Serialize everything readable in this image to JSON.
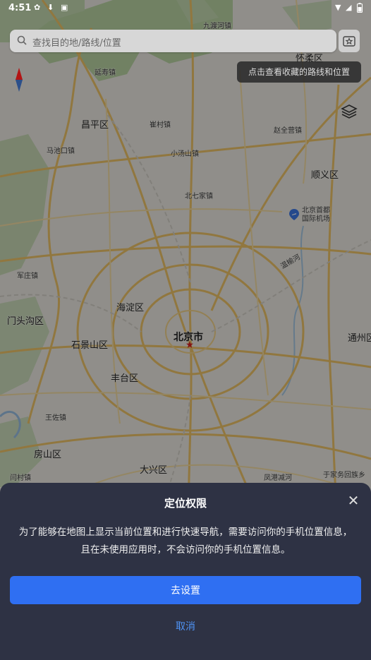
{
  "status_bar": {
    "time": "4:51",
    "battery_icon": "battery-icon"
  },
  "search": {
    "placeholder": "查找目的地/路线/位置"
  },
  "favorites_tip": "点击查看收藏的路线和位置",
  "map_labels": {
    "beijing": "北京市",
    "haidian": "海淀区",
    "changping": "昌平区",
    "shunyi": "顺义区",
    "mentougou": "门头沟区",
    "shijingshan": "石景山区",
    "fengtai": "丰台区",
    "fangshan": "房山区",
    "daxing": "大兴区",
    "huairou": "怀柔区",
    "tongzhou": "通州区",
    "airport": "北京首都\n国际机场",
    "jiudu_river": "九渡河镇",
    "yanshou": "延寿镇",
    "cuicun": "崔村镇",
    "zhaoquanying": "赵全营镇",
    "machikou": "马池口镇",
    "xiaotangshan": "小汤山镇",
    "beiqijia": "北七家镇",
    "junzhuang": "军庄镇",
    "wangzuo": "王佐镇",
    "yanchi": "闫村镇",
    "yuzhuang": "于家务回族乡",
    "fenggang": "凤港减河",
    "wenyu": "温榆河"
  },
  "dialog": {
    "title": "定位权限",
    "message_line1": "为了能够在地图上显示当前位置和进行快速导航，需要访问你的手机位置信息，",
    "message_line2": "且在未使用应用时，不会访问你的手机位置信息。",
    "confirm_label": "去设置",
    "cancel_label": "取消",
    "close_icon": "close-icon"
  },
  "colors": {
    "primary": "#2f6ff2",
    "sheet_bg": "#2e3244",
    "link": "#4f93f5"
  }
}
